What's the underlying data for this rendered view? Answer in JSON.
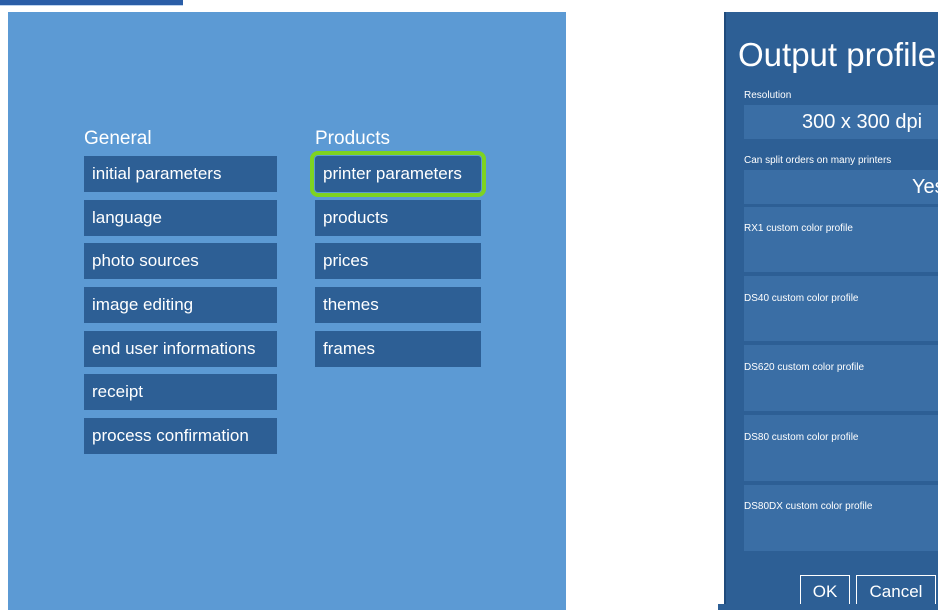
{
  "settings": {
    "general_heading": "General",
    "products_heading": "Products",
    "general_items": [
      "initial parameters",
      "language",
      "photo sources",
      "image editing",
      "end user informations",
      "receipt",
      "process confirmation"
    ],
    "products_items": [
      "printer parameters",
      "products",
      "prices",
      "themes",
      "frames"
    ],
    "selected_item": "printer parameters"
  },
  "dialog": {
    "title": "Output profile",
    "resolution_label": "Resolution",
    "resolution_value": "300 x 300 dpi",
    "split_label": "Can split orders on many printers",
    "split_value": "Yes",
    "profiles": [
      "RX1 custom color profile",
      "DS40 custom color profile",
      "DS620 custom color profile",
      "DS80 custom color profile",
      "DS80DX custom color profile"
    ],
    "ok_label": "OK",
    "cancel_label": "Cancel"
  },
  "colors": {
    "panel_bg": "#5c9ad4",
    "button_bg": "#2d5f95",
    "highlight": "#7ed321"
  }
}
